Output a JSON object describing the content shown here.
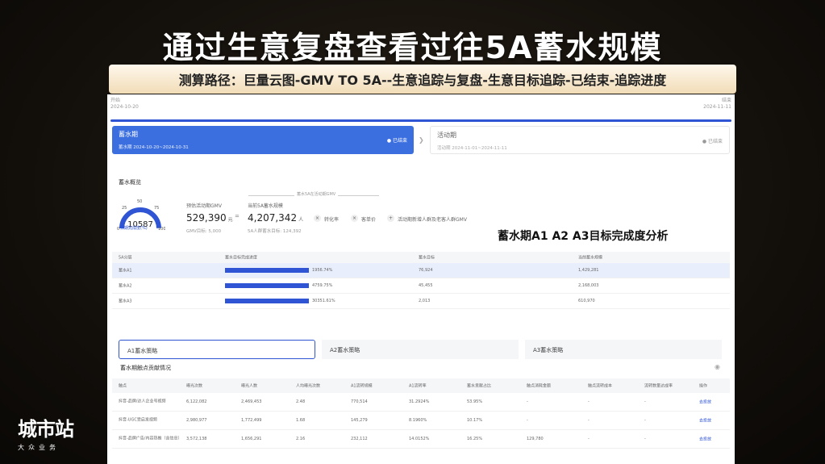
{
  "title": "通过生意复盘查看过往5A蓄水规模",
  "banner": "测算路径：巨量云图-GMV TO 5A--生意追踪与复盘-生意目标追踪-已结束-追踪进度",
  "timeline": {
    "start_label": "开始",
    "start_date": "2024-10-20",
    "end_label": "结束",
    "end_date": "2024-11-11"
  },
  "phases": [
    {
      "name": "蓄水期",
      "date": "蓄水期 2024-10-20~2024-10-31",
      "status": "● 已结束"
    },
    {
      "name": "活动期",
      "date": "活动期 2024-11-01~2024-11-11",
      "status": "● 已结束"
    }
  ],
  "overview": {
    "title": "蓄水概览",
    "gauge": {
      "value": "10587",
      "label": "预期完成度(%)",
      "ticks": [
        "0",
        "25",
        "50",
        "75",
        "100"
      ],
      "progress": 1.0
    },
    "est_gmv_label": "预估活动期GMV",
    "est_gmv_value": "529,390",
    "est_gmv_unit": "元",
    "gmv_target": "GMV目标: 5,000",
    "equals": "=",
    "bracket_text": "蓄水5A在活动期GMV",
    "scale_label": "当前5A蓄水规模",
    "scale_value": "4,207,342",
    "scale_unit": "人",
    "scale_target": "5A人群蓄水目标: 124,392",
    "times": "×",
    "plus": "+",
    "conversion_label": "转化率",
    "price_label": "客单价",
    "new_label": "活动期新增人群及老客人群GMV"
  },
  "caption": "蓄水期A1 A2 A3目标完成度分析",
  "table1": {
    "headers": [
      "5A分层",
      "蓄水目标完成进度",
      "蓄水目标",
      "当前蓄水规模"
    ],
    "rows": [
      {
        "layer": "蓄水A1",
        "progress": "1956.74%",
        "fill": 1.0,
        "target": "76,924",
        "current": "1,429,281"
      },
      {
        "layer": "蓄水A2",
        "progress": "4759.75%",
        "fill": 1.0,
        "target": "45,455",
        "current": "2,168,003"
      },
      {
        "layer": "蓄水A3",
        "progress": "30351.61%",
        "fill": 1.0,
        "target": "2,013",
        "current": "610,970"
      }
    ]
  },
  "tabs": [
    "A1蓄水策略",
    "A2蓄水策略",
    "A3蓄水策略"
  ],
  "section_title": "蓄水期触点贡献情况",
  "table2": {
    "headers": [
      "触点",
      "曝光次数",
      "曝光人数",
      "人均曝光次数",
      "A1流转规模",
      "A1流转率",
      "蓄水贡献占比",
      "触点消耗金额",
      "触点流转成本",
      "流转数量达成率",
      "操作"
    ],
    "rows": [
      [
        "抖音-品牌/达人企业号视频",
        "6,122,082",
        "2,469,453",
        "2.48",
        "770,514",
        "31.2924%",
        "53.95%",
        "-",
        "-",
        "-",
        "去投放"
      ],
      [
        "抖音-UGC受启发视频",
        "2,980,977",
        "1,772,499",
        "1.68",
        "145,279",
        "8.1960%",
        "10.17%",
        "-",
        "-",
        "-",
        "去投放"
      ],
      [
        "抖音-品牌广告/内容热推（含信息）",
        "3,572,138",
        "1,656,291",
        "2.16",
        "232,112",
        "14.0152%",
        "16.25%",
        "129,780",
        "-",
        "-",
        "去投放"
      ]
    ]
  },
  "logo": {
    "main": "城市站",
    "sub": "大众业务"
  }
}
